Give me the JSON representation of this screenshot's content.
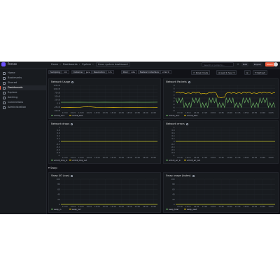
{
  "app": {
    "brand": "Perses",
    "colors": {
      "background": "#111217",
      "panel": "#181b1f",
      "accent": "#f55f3e",
      "brand": "#6e52ff"
    }
  },
  "topbar": {
    "breadcrumbs": [
      "Home",
      "Dashboards",
      "System"
    ],
    "current_dashboard": "Linux system dashboard",
    "search_placeholder": "Search or jump to...",
    "edit_label": "Edit",
    "export_label": "Export",
    "share_label": "Share"
  },
  "sidebar": {
    "items": [
      {
        "label": "Home",
        "icon": "home-icon"
      },
      {
        "label": "Bookmarks",
        "icon": "bookmark-icon"
      },
      {
        "label": "Starred",
        "icon": "star-icon"
      },
      {
        "label": "Dashboards",
        "icon": "dashboards-icon",
        "active": true
      },
      {
        "label": "Explore",
        "icon": "compass-icon"
      },
      {
        "label": "Alerting",
        "icon": "bell-icon"
      },
      {
        "label": "Connections",
        "icon": "plug-icon"
      },
      {
        "label": "Administration",
        "icon": "gear-icon"
      }
    ]
  },
  "controls": {
    "variables": [
      {
        "name": "Sampling",
        "value": "1m"
      },
      {
        "name": "Instance",
        "value": "pve"
      },
      {
        "name": "Resolution",
        "value": "1m"
      },
      {
        "name": "Disk",
        "value": "sda"
      },
      {
        "name": "Network interface",
        "value": "vmbr0"
      }
    ],
    "mode_label": "Kiosk mode",
    "time_range": "Last 1 hour",
    "refresh_label": "Refresh"
  },
  "time_ticks": [
    "13:10",
    "13:15",
    "13:20",
    "13:25",
    "13:30",
    "13:35",
    "13:40",
    "13:45",
    "13:50",
    "13:55",
    "14:00",
    "14:05"
  ],
  "panels": {
    "network_usage": {
      "title": "Network Usage",
      "y_ticks": [
        "125 kB",
        "100 kB",
        "75 kB",
        "50 kB",
        "25 kB",
        "0 B",
        "-25 kB",
        "-50 kB"
      ],
      "legend": [
        "vmbr0_recv",
        "vmbr0_sent"
      ]
    },
    "network_packets": {
      "title": "Network Packets",
      "y_ticks": [
        "8",
        "6",
        "4",
        "2",
        "0",
        "-2",
        "-4",
        "-6",
        "-8"
      ],
      "legend": [
        "vmbr0_recv",
        "vmbr0_sent"
      ]
    },
    "network_drops": {
      "title": "Network drops",
      "y_ticks": [
        "1",
        "0.8",
        "0.6",
        "0.4",
        "0.2",
        "0",
        "-0.2",
        "-0.4",
        "-0.6",
        "-0.8",
        "-1"
      ],
      "legend": [
        "vmbr0_drop_in",
        "vmbr0_drop_out"
      ]
    },
    "network_errors": {
      "title": "Network errors",
      "y_ticks": [
        "1",
        "0.8",
        "0.6",
        "0.4",
        "0.2",
        "0",
        "-0.2",
        "-0.4",
        "-0.6",
        "-0.8",
        "-1"
      ],
      "legend": [
        "vmbr0_err_in",
        "vmbr0_err_out"
      ]
    },
    "row_swap": {
      "title": "Swap"
    },
    "swap_io": {
      "title": "Swap I/O (ops)",
      "y_ticks": [
        "100",
        "80",
        "60",
        "40",
        "20",
        "0"
      ],
      "legend": [
        "swap_in",
        "swap_out"
      ]
    },
    "swap_usage": {
      "title": "Swap usage (bytes)",
      "y_ticks": [
        "100",
        "80",
        "60",
        "40",
        "20",
        "0"
      ],
      "legend": [
        "swap_total",
        "swap_used"
      ]
    }
  },
  "chart_data": [
    {
      "type": "line",
      "title": "Network Usage",
      "x": [
        "13:10",
        "13:15",
        "13:20",
        "13:25",
        "13:30",
        "13:35",
        "13:40",
        "13:45",
        "13:50",
        "13:55",
        "14:00",
        "14:05"
      ],
      "ylim": [
        -50,
        125
      ],
      "series": [
        {
          "name": "vmbr0_recv",
          "color": "#73bf69",
          "values": [
            8,
            8,
            9,
            8,
            8,
            9,
            8,
            8,
            9,
            8,
            8,
            9
          ]
        },
        {
          "name": "vmbr0_sent",
          "color": "#f2cc0c",
          "values": [
            -28,
            -27,
            -28,
            -22,
            -27,
            -28,
            -27,
            -28,
            -27,
            -27,
            -28,
            -27
          ]
        }
      ]
    },
    {
      "type": "line",
      "title": "Network Packets",
      "x": [
        "13:10",
        "13:15",
        "13:20",
        "13:25",
        "13:30",
        "13:35",
        "13:40",
        "13:45",
        "13:50",
        "13:55",
        "14:00",
        "14:05"
      ],
      "ylim": [
        -8,
        8
      ],
      "series": [
        {
          "name": "vmbr0_recv",
          "color": "#73bf69",
          "values": [
            -3,
            -6,
            -3,
            -6,
            -3,
            -6,
            -3,
            -6,
            -3,
            -6,
            -3,
            -6
          ]
        },
        {
          "name": "vmbr0_sent",
          "color": "#f2cc0c",
          "values": [
            3.5,
            3.2,
            3.5,
            3.0,
            3.5,
            0.5,
            3.4,
            3.3,
            3.5,
            3.2,
            3.5,
            3.3
          ]
        }
      ]
    },
    {
      "type": "line",
      "title": "Network drops",
      "x": [
        "13:10",
        "14:05"
      ],
      "ylim": [
        -1,
        1
      ],
      "series": [
        {
          "name": "vmbr0_drop_in",
          "color": "#73bf69",
          "values": [
            0,
            0
          ]
        },
        {
          "name": "vmbr0_drop_out",
          "color": "#f2cc0c",
          "values": [
            0,
            0
          ]
        }
      ]
    },
    {
      "type": "line",
      "title": "Network errors",
      "x": [
        "13:10",
        "14:05"
      ],
      "ylim": [
        -1,
        1
      ],
      "series": [
        {
          "name": "vmbr0_err_in",
          "color": "#73bf69",
          "values": [
            0,
            0
          ]
        },
        {
          "name": "vmbr0_err_out",
          "color": "#f2cc0c",
          "values": [
            0,
            0
          ]
        }
      ]
    },
    {
      "type": "line",
      "title": "Swap I/O (ops)",
      "x": [
        "13:10",
        "14:05"
      ],
      "ylim": [
        0,
        100
      ],
      "series": [
        {
          "name": "swap_in",
          "color": "#73bf69",
          "values": [
            0,
            0
          ]
        },
        {
          "name": "swap_out",
          "color": "#f2cc0c",
          "values": [
            0,
            0
          ]
        }
      ]
    },
    {
      "type": "line",
      "title": "Swap usage (bytes)",
      "x": [
        "13:10",
        "14:05"
      ],
      "ylim": [
        0,
        100
      ],
      "series": [
        {
          "name": "swap_total",
          "color": "#73bf69",
          "values": [
            0,
            0
          ]
        },
        {
          "name": "swap_used",
          "color": "#f2cc0c",
          "values": [
            0,
            0
          ]
        }
      ]
    }
  ]
}
